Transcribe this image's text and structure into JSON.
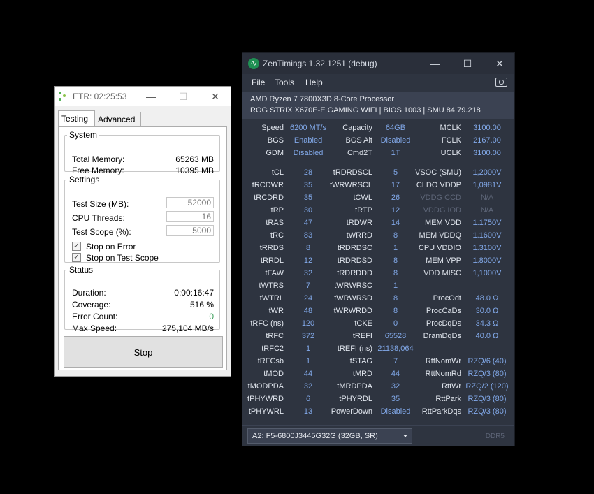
{
  "tm5": {
    "title": "ETR: 02:25:53",
    "tabs": [
      "Testing",
      "Advanced"
    ],
    "system": {
      "legend": "System",
      "rows": [
        {
          "label": "Total Memory:",
          "value": "65263 MB"
        },
        {
          "label": "Free Memory:",
          "value": "10395 MB"
        }
      ]
    },
    "settings": {
      "legend": "Settings",
      "inputs": [
        {
          "label": "Test Size (MB):",
          "value": "52000"
        },
        {
          "label": "CPU Threads:",
          "value": "16"
        },
        {
          "label": "Test Scope (%):",
          "value": "5000"
        }
      ],
      "checks": [
        {
          "label": "Stop on Error",
          "checked": true
        },
        {
          "label": "Stop on Test Scope",
          "checked": true
        }
      ]
    },
    "status": {
      "legend": "Status",
      "rows": [
        {
          "label": "Duration:",
          "value": "0:00:16:47"
        },
        {
          "label": "Coverage:",
          "value": "516 %"
        },
        {
          "label": "Error Count:",
          "value": "0"
        },
        {
          "label": "Max Speed:",
          "value": "275,104 MB/s"
        }
      ]
    },
    "stop_label": "Stop"
  },
  "zt": {
    "title": "ZenTimings 1.32.1251 (debug)",
    "menus": [
      "File",
      "Tools",
      "Help"
    ],
    "cpu": "AMD Ryzen 7 7800X3D 8-Core Processor",
    "board": "ROG STRIX X670E-E GAMING WIFI | BIOS 1003 | SMU 84.79.218",
    "top_rows": [
      [
        "Speed",
        "6200 MT/s",
        "Capacity",
        "64GB",
        "MCLK",
        "3100.00"
      ],
      [
        "BGS",
        "Enabled",
        "BGS Alt",
        "Disabled",
        "FCLK",
        "2167.00"
      ],
      [
        "GDM",
        "Disabled",
        "Cmd2T",
        "1T",
        "UCLK",
        "3100.00"
      ]
    ],
    "rows": [
      [
        "tCL",
        "28",
        "tRDRDSCL",
        "5",
        "VSOC (SMU)",
        "1,2000V"
      ],
      [
        "tRCDWR",
        "35",
        "tWRWRSCL",
        "17",
        "CLDO VDDP",
        "1,0981V"
      ],
      [
        "tRCDRD",
        "35",
        "tCWL",
        "26",
        "VDDG CCD",
        "N/A"
      ],
      [
        "tRP",
        "30",
        "tRTP",
        "12",
        "VDDG IOD",
        "N/A"
      ],
      [
        "tRAS",
        "47",
        "tRDWR",
        "14",
        "MEM VDD",
        "1.1750V"
      ],
      [
        "tRC",
        "83",
        "tWRRD",
        "8",
        "MEM VDDQ",
        "1.1600V"
      ],
      [
        "tRRDS",
        "8",
        "tRDRDSC",
        "1",
        "CPU VDDIO",
        "1.3100V"
      ],
      [
        "tRRDL",
        "12",
        "tRDRDSD",
        "8",
        "MEM VPP",
        "1.8000V"
      ],
      [
        "tFAW",
        "32",
        "tRDRDDD",
        "8",
        "VDD MISC",
        "1,1000V"
      ],
      [
        "tWTRS",
        "7",
        "tWRWRSC",
        "1",
        "",
        ""
      ],
      [
        "tWTRL",
        "24",
        "tWRWRSD",
        "8",
        "ProcOdt",
        "48.0 Ω"
      ],
      [
        "tWR",
        "48",
        "tWRWRDD",
        "8",
        "ProcCaDs",
        "30.0 Ω"
      ],
      [
        "tRFC (ns)",
        "120",
        "tCKE",
        "0",
        "ProcDqDs",
        "34.3 Ω"
      ],
      [
        "tRFC",
        "372",
        "tREFI",
        "65528",
        "DramDqDs",
        "40.0 Ω"
      ],
      [
        "tRFC2",
        "1",
        "tREFI (ns)",
        "21138,064",
        "",
        ""
      ],
      [
        "tRFCsb",
        "1",
        "tSTAG",
        "7",
        "RttNomWr",
        "RZQ/6 (40)"
      ],
      [
        "tMOD",
        "44",
        "tMRD",
        "44",
        "RttNomRd",
        "RZQ/3 (80)"
      ],
      [
        "tMODPDA",
        "32",
        "tMRDPDA",
        "32",
        "RttWr",
        "RZQ/2 (120)"
      ],
      [
        "tPHYWRD",
        "6",
        "tPHYRDL",
        "35",
        "RttPark",
        "RZQ/3 (80)"
      ],
      [
        "tPHYWRL",
        "13",
        "PowerDown",
        "Disabled",
        "RttParkDqs",
        "RZQ/3 (80)"
      ]
    ],
    "dim_labels": [
      "VDDG CCD",
      "VDDG IOD"
    ],
    "dimm": "A2: F5-6800J3445G32G (32GB, SR)",
    "ddr": "DDR5"
  }
}
